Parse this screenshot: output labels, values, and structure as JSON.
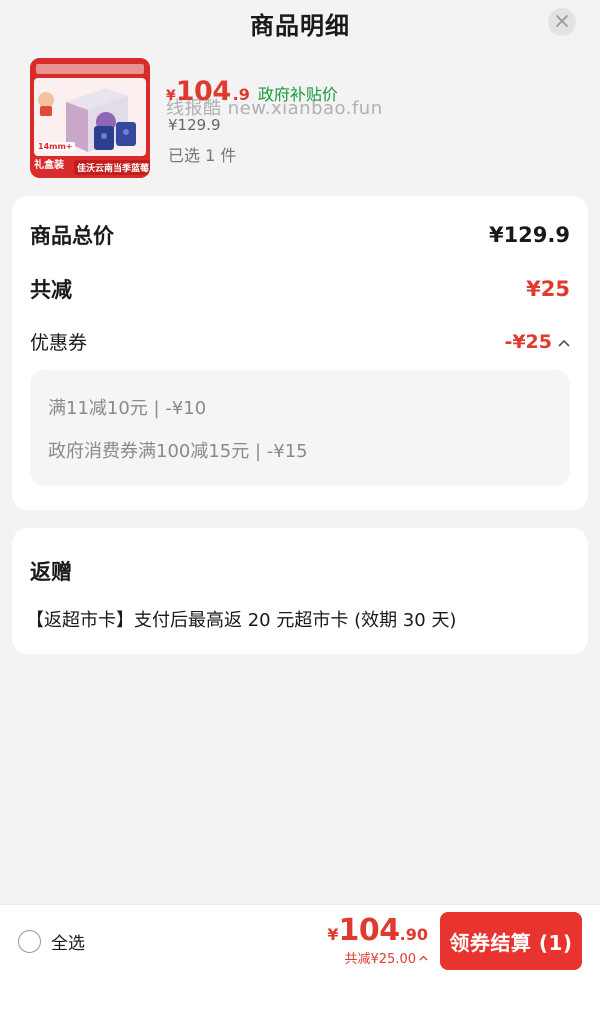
{
  "header": {
    "title": "商品明细",
    "close_icon": "close-icon"
  },
  "product": {
    "price_currency": "¥",
    "price_integer": "104",
    "price_decimal": ".9",
    "subsidy_label": "政府补贴价",
    "watermark": "线报酷 new.xianbao.fun",
    "original_price": "¥129.9",
    "selected_count": "已选 1 件",
    "thumbnail_text": {
      "badge": "14mm+",
      "gift_box": "礼盒装",
      "banner": "佳沃云南当季蓝莓"
    },
    "colors": {
      "price": "#e03a2f",
      "subsidy": "#1a9a3c",
      "thumb_bg": "#d92b2b"
    }
  },
  "summary": {
    "total_label": "商品总价",
    "total_value": "¥129.9",
    "reduce_label": "共减",
    "reduce_value": "¥25",
    "coupon_label": "优惠券",
    "coupon_value": "-¥25",
    "coupon_toggle_icon": "chevron-up-icon",
    "coupons": [
      {
        "text": "满11减10元 | -¥10"
      },
      {
        "text": "政府消费券满100减15元 | -¥15"
      }
    ]
  },
  "gift": {
    "title": "返赠",
    "text": "【返超市卡】支付后最高返 20 元超市卡 (效期 30 天)"
  },
  "bottom_bar": {
    "select_all_label": "全选",
    "total_currency": "¥",
    "total_integer": "104",
    "total_decimal": ".90",
    "total_reduce": "共减¥25.00",
    "checkout_label": "领券结算 (1)",
    "colors": {
      "accent": "#e8332f"
    }
  }
}
